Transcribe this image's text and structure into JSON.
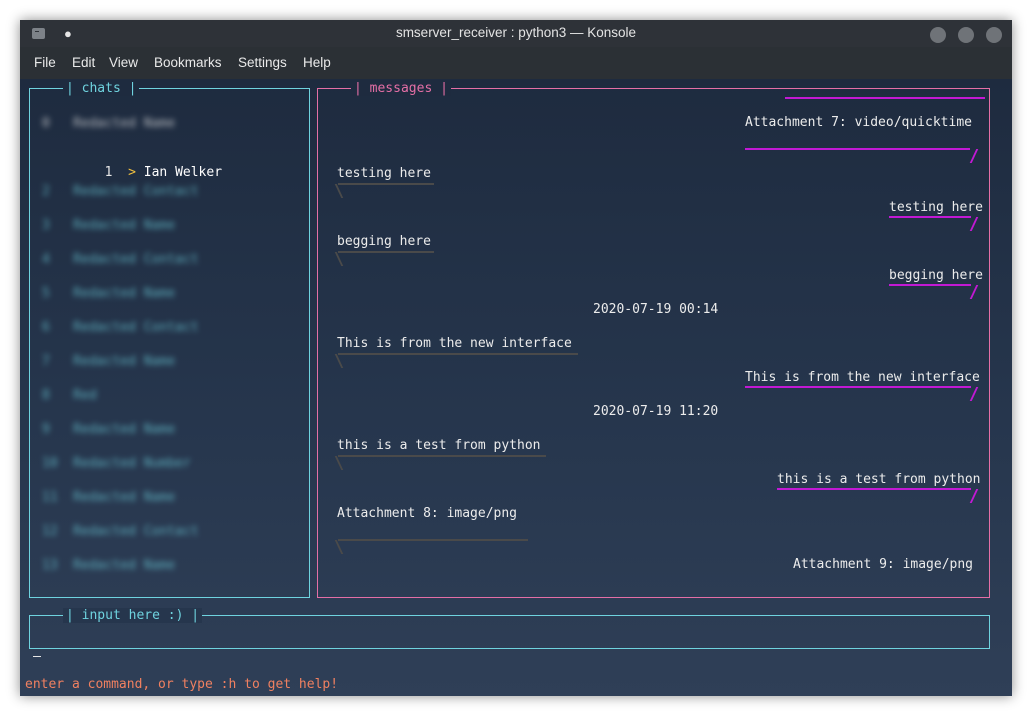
{
  "window": {
    "title": "smserver_receiver : python3 — Konsole",
    "tab_dot": "●"
  },
  "menu": [
    "File",
    "Edit",
    "View",
    "Bookmarks",
    "Settings",
    "Help"
  ],
  "chats": {
    "title": "| chats |",
    "selected": {
      "index": "1",
      "marker": ">",
      "name": "Ian Welker"
    },
    "blurred": [
      "0   Redacted Name",
      "2   Redacted Contact",
      "3   Redacted Name",
      "4   Redacted Contact",
      "5   Redacted Name",
      "6   Redacted Contact",
      "7   Redacted Name",
      "8   Red",
      "9   Redacted Name",
      "10  Redacted Number",
      "11  Redacted Name",
      "12  Redacted Contact",
      "13  Redacted Name"
    ]
  },
  "messages": {
    "title": "| messages |",
    "items": [
      {
        "text": "Attachment 7: video/quicktime",
        "side": "right"
      },
      {
        "text": "testing here",
        "side": "left"
      },
      {
        "text": "testing here",
        "side": "right"
      },
      {
        "text": "begging here",
        "side": "left"
      },
      {
        "text": "begging here",
        "side": "right"
      },
      {
        "text": "2020-07-19 00:14",
        "side": "center"
      },
      {
        "text": "This is from the new interface",
        "side": "left"
      },
      {
        "text": "This is from the new interface",
        "side": "right"
      },
      {
        "text": "2020-07-19 11:20",
        "side": "center"
      },
      {
        "text": "this is a test from python",
        "side": "left"
      },
      {
        "text": "this is a test from python",
        "side": "right"
      },
      {
        "text": "Attachment 8: image/png",
        "side": "left"
      },
      {
        "text": "Attachment 9: image/png",
        "side": "right"
      }
    ]
  },
  "input": {
    "title": "| input here :) |",
    "cursor": "_"
  },
  "status": "enter a command, or type :h to get help!",
  "colors": {
    "cyan": "#6fd3df",
    "pink": "#e56fa6",
    "magenta": "#c219d4",
    "status": "#f08060",
    "selection_arrow": "#f0c040"
  }
}
